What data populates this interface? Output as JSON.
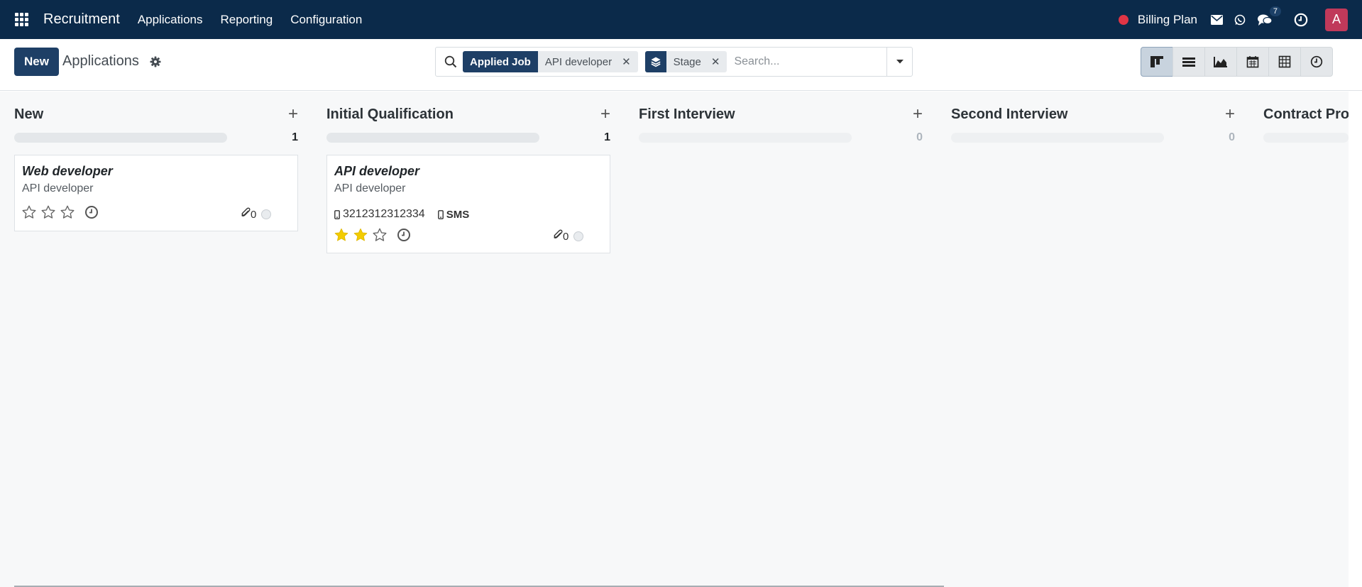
{
  "navbar": {
    "app_name": "Recruitment",
    "menu": [
      "Applications",
      "Reporting",
      "Configuration"
    ],
    "billing_label": "Billing Plan",
    "chat_count": "7",
    "avatar_letter": "A"
  },
  "control": {
    "new_label": "New",
    "title": "Applications",
    "facets": [
      {
        "label": "Applied Job",
        "value": "API developer"
      },
      {
        "label": "",
        "icon": "layers-icon",
        "value": "Stage"
      }
    ],
    "search_placeholder": "Search...",
    "views": [
      "kanban-view-icon",
      "list-view-icon",
      "graph-view-icon",
      "calendar-view-icon",
      "pivot-view-icon",
      "activity-view-icon"
    ],
    "active_view": "kanban-view-icon"
  },
  "columns": [
    {
      "title": "New",
      "count": "1",
      "cards": [
        {
          "title": "Web developer",
          "job": "API developer",
          "rating": 0,
          "attachments": "0"
        }
      ]
    },
    {
      "title": "Initial Qualification",
      "count": "1",
      "cards": [
        {
          "title": "API developer",
          "job": "API developer",
          "phone": "3212312312334",
          "sms_label": "SMS",
          "rating": 2,
          "attachments": "0"
        }
      ]
    },
    {
      "title": "First Interview",
      "count": "0",
      "cards": []
    },
    {
      "title": "Second Interview",
      "count": "0",
      "cards": []
    },
    {
      "title": "Contract Pro",
      "count": "",
      "cards": []
    }
  ],
  "colors": {
    "navbar": "#0b2a4a",
    "primary": "#1e3f66",
    "star_filled": "#f3cc00",
    "notification_dot": "#e03545",
    "avatar": "#c0395a"
  }
}
